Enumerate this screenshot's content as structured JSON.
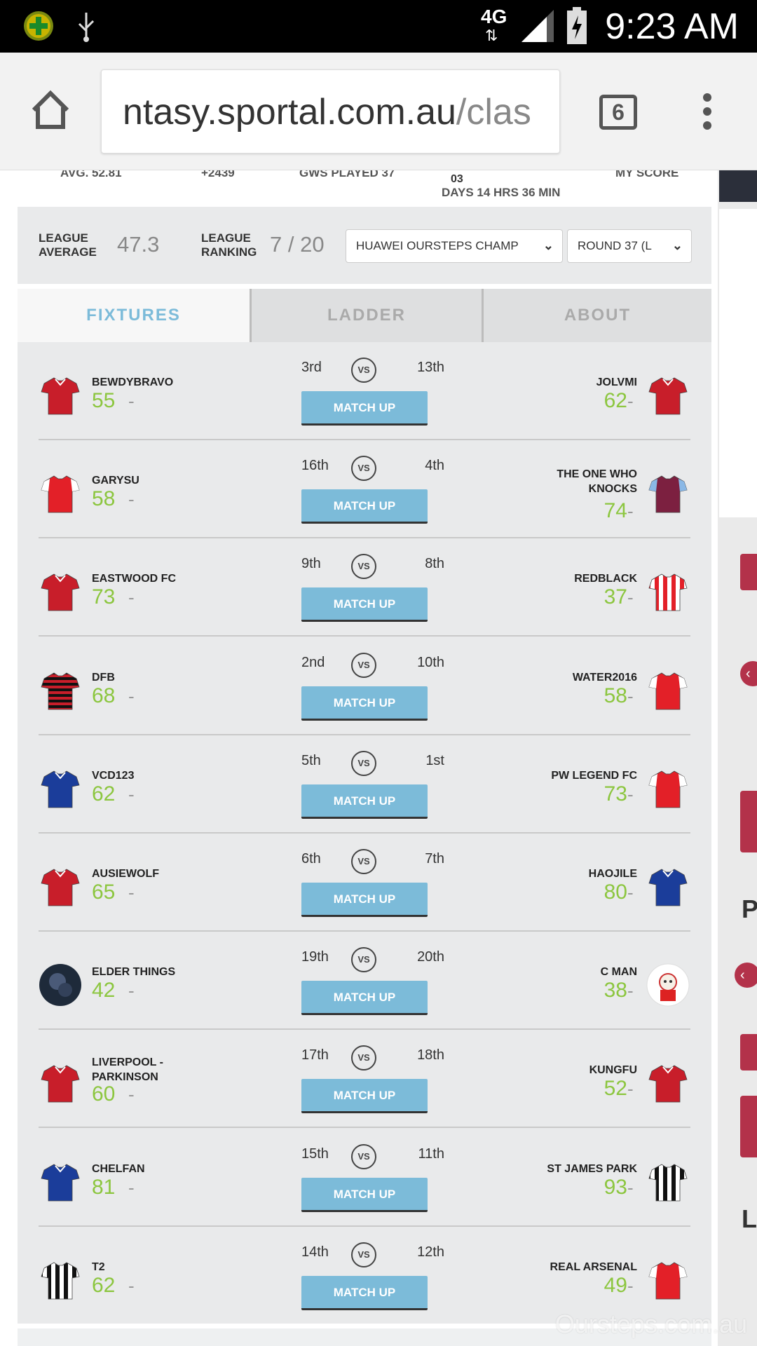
{
  "status_bar": {
    "time": "9:23 AM",
    "network": "4G"
  },
  "browser": {
    "url_host": "ntasy.sportal.com.au",
    "url_path": "/clas",
    "tab_count": "6"
  },
  "top_stats": {
    "avg": "AVG. 52.81",
    "rank_change": "+2439",
    "gws_played": "GWS PLAYED 37",
    "countdown_days_num": "03",
    "countdown": "DAYS 14 HRS 36 MIN",
    "my_score": "MY SCORE"
  },
  "league": {
    "average_label": "LEAGUE AVERAGE",
    "average_value": "47.3",
    "ranking_label": "LEAGUE RANKING",
    "ranking_value": "7 / 20",
    "league_select": "HUAWEI OURSTEPS CHAMP",
    "round_select": "ROUND 37 (L"
  },
  "tabs": [
    "FIXTURES",
    "LADDER",
    "ABOUT"
  ],
  "match_up_label": "MATCH UP",
  "vs_label": "VS",
  "fixtures": [
    {
      "home": "BEWDYBRAVO",
      "home_score": "55",
      "home_rank": "3rd",
      "away_rank": "13th",
      "away": "JOLVMI",
      "away_score": "62",
      "home_kit": "red",
      "away_kit": "red"
    },
    {
      "home": "GARYSU",
      "home_score": "58",
      "home_rank": "16th",
      "away_rank": "4th",
      "away": "THE ONE WHO KNOCKS",
      "away_score": "74",
      "home_kit": "arsenal",
      "away_kit": "claret"
    },
    {
      "home": "EASTWOOD FC",
      "home_score": "73",
      "home_rank": "9th",
      "away_rank": "8th",
      "away": "REDBLACK",
      "away_score": "37",
      "home_kit": "red",
      "away_kit": "stripes_red"
    },
    {
      "home": "DFB",
      "home_score": "68",
      "home_rank": "2nd",
      "away_rank": "10th",
      "away": "WATER2016",
      "away_score": "58",
      "home_kit": "dfb",
      "away_kit": "arsenal"
    },
    {
      "home": "VCD123",
      "home_score": "62",
      "home_rank": "5th",
      "away_rank": "1st",
      "away": "PW LEGEND FC",
      "away_score": "73",
      "home_kit": "blue",
      "away_kit": "arsenal"
    },
    {
      "home": "AUSIEWOLF",
      "home_score": "65",
      "home_rank": "6th",
      "away_rank": "7th",
      "away": "HAOJILE",
      "away_score": "80",
      "home_kit": "red",
      "away_kit": "blue"
    },
    {
      "home": "ELDER THINGS",
      "home_score": "42",
      "home_rank": "19th",
      "away_rank": "20th",
      "away": "C MAN",
      "away_score": "38",
      "home_kit": "avatar_dark",
      "away_kit": "avatar_cat"
    },
    {
      "home": "LIVERPOOL - PARKINSON",
      "home_score": "60",
      "home_rank": "17th",
      "away_rank": "18th",
      "away": "KUNGFU",
      "away_score": "52",
      "home_kit": "red",
      "away_kit": "red"
    },
    {
      "home": "CHELFAN",
      "home_score": "81",
      "home_rank": "15th",
      "away_rank": "11th",
      "away": "ST JAMES PARK",
      "away_score": "93",
      "home_kit": "blue",
      "away_kit": "stripes_bw"
    },
    {
      "home": "T2",
      "home_score": "62",
      "home_rank": "14th",
      "away_rank": "12th",
      "away": "REAL ARSENAL",
      "away_score": "49",
      "home_kit": "stripes_bw",
      "away_kit": "arsenal"
    }
  ],
  "dash": "-",
  "watermark": "Oursteps.com.au",
  "colors": {
    "accent_blue": "#7cbbd9",
    "score_green": "#8cc63f",
    "panel_gray": "#e9eaeb"
  }
}
